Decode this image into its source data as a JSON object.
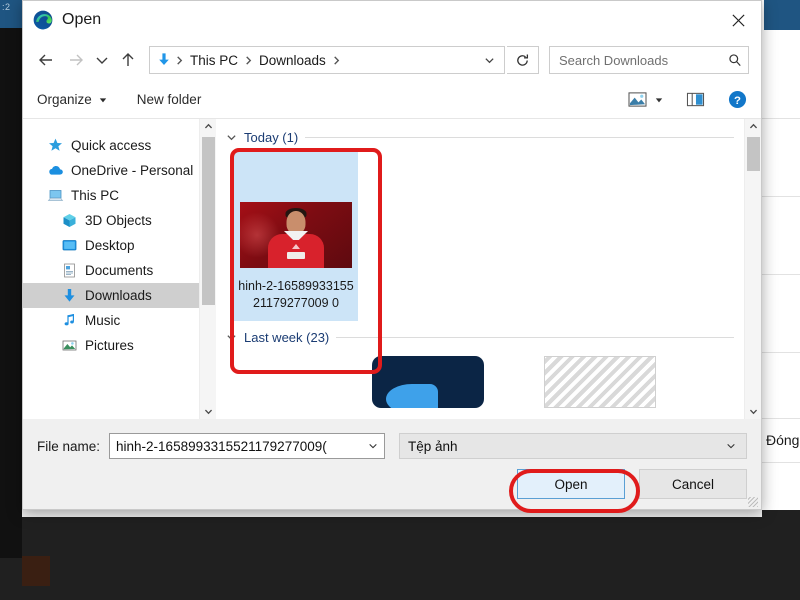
{
  "dialog": {
    "title": "Open",
    "app_icon": "edge-logo-icon",
    "close_label": "Close"
  },
  "nav": {
    "back": "Back",
    "forward": "Forward",
    "recent": "Recent locations",
    "up": "Up one level",
    "refresh": "Refresh",
    "breadcrumbs": [
      "This PC",
      "Downloads"
    ],
    "location_icon": "downloads-arrow-icon"
  },
  "search": {
    "placeholder": "Search Downloads",
    "icon": "search-icon"
  },
  "commandbar": {
    "organize": "Organize",
    "new_folder": "New folder",
    "view_icon": "view-layout-icon",
    "preview_icon": "preview-pane-icon",
    "help_icon": "help-icon"
  },
  "sidebar": {
    "items": [
      {
        "label": "Quick access",
        "icon": "star-icon",
        "indented": false,
        "selected": false
      },
      {
        "label": "OneDrive - Personal",
        "icon": "cloud-icon",
        "indented": false,
        "selected": false
      },
      {
        "label": "This PC",
        "icon": "computer-icon",
        "indented": false,
        "selected": false
      },
      {
        "label": "3D Objects",
        "icon": "cube-icon",
        "indented": true,
        "selected": false
      },
      {
        "label": "Desktop",
        "icon": "desktop-icon",
        "indented": true,
        "selected": false
      },
      {
        "label": "Documents",
        "icon": "document-icon",
        "indented": true,
        "selected": false
      },
      {
        "label": "Downloads",
        "icon": "downloads-arrow-icon",
        "indented": true,
        "selected": true
      },
      {
        "label": "Music",
        "icon": "music-note-icon",
        "indented": true,
        "selected": false
      },
      {
        "label": "Pictures",
        "icon": "picture-icon",
        "indented": true,
        "selected": false
      }
    ]
  },
  "content": {
    "groups": [
      {
        "label": "Today (1)",
        "chevron": "chevron-down-icon"
      },
      {
        "label": "Last week (23)",
        "chevron": "chevron-down-icon"
      }
    ],
    "today_file": {
      "name": "hinh-2-1658993315521179277009 0",
      "selected": true,
      "thumbnail": "football-player-red-jersey"
    }
  },
  "footer": {
    "file_name_label": "File name:",
    "file_name_value": "hinh-2-1658993315521179277009(",
    "file_type_value": "Tệp ảnh",
    "open_button": "Open",
    "cancel_button": "Cancel"
  },
  "background": {
    "close_text_partial": "Đóng",
    "tile_text": ":2"
  },
  "annotations": {
    "color": "#e01b1b",
    "targets": [
      "selected-file-tile",
      "open-button"
    ]
  }
}
